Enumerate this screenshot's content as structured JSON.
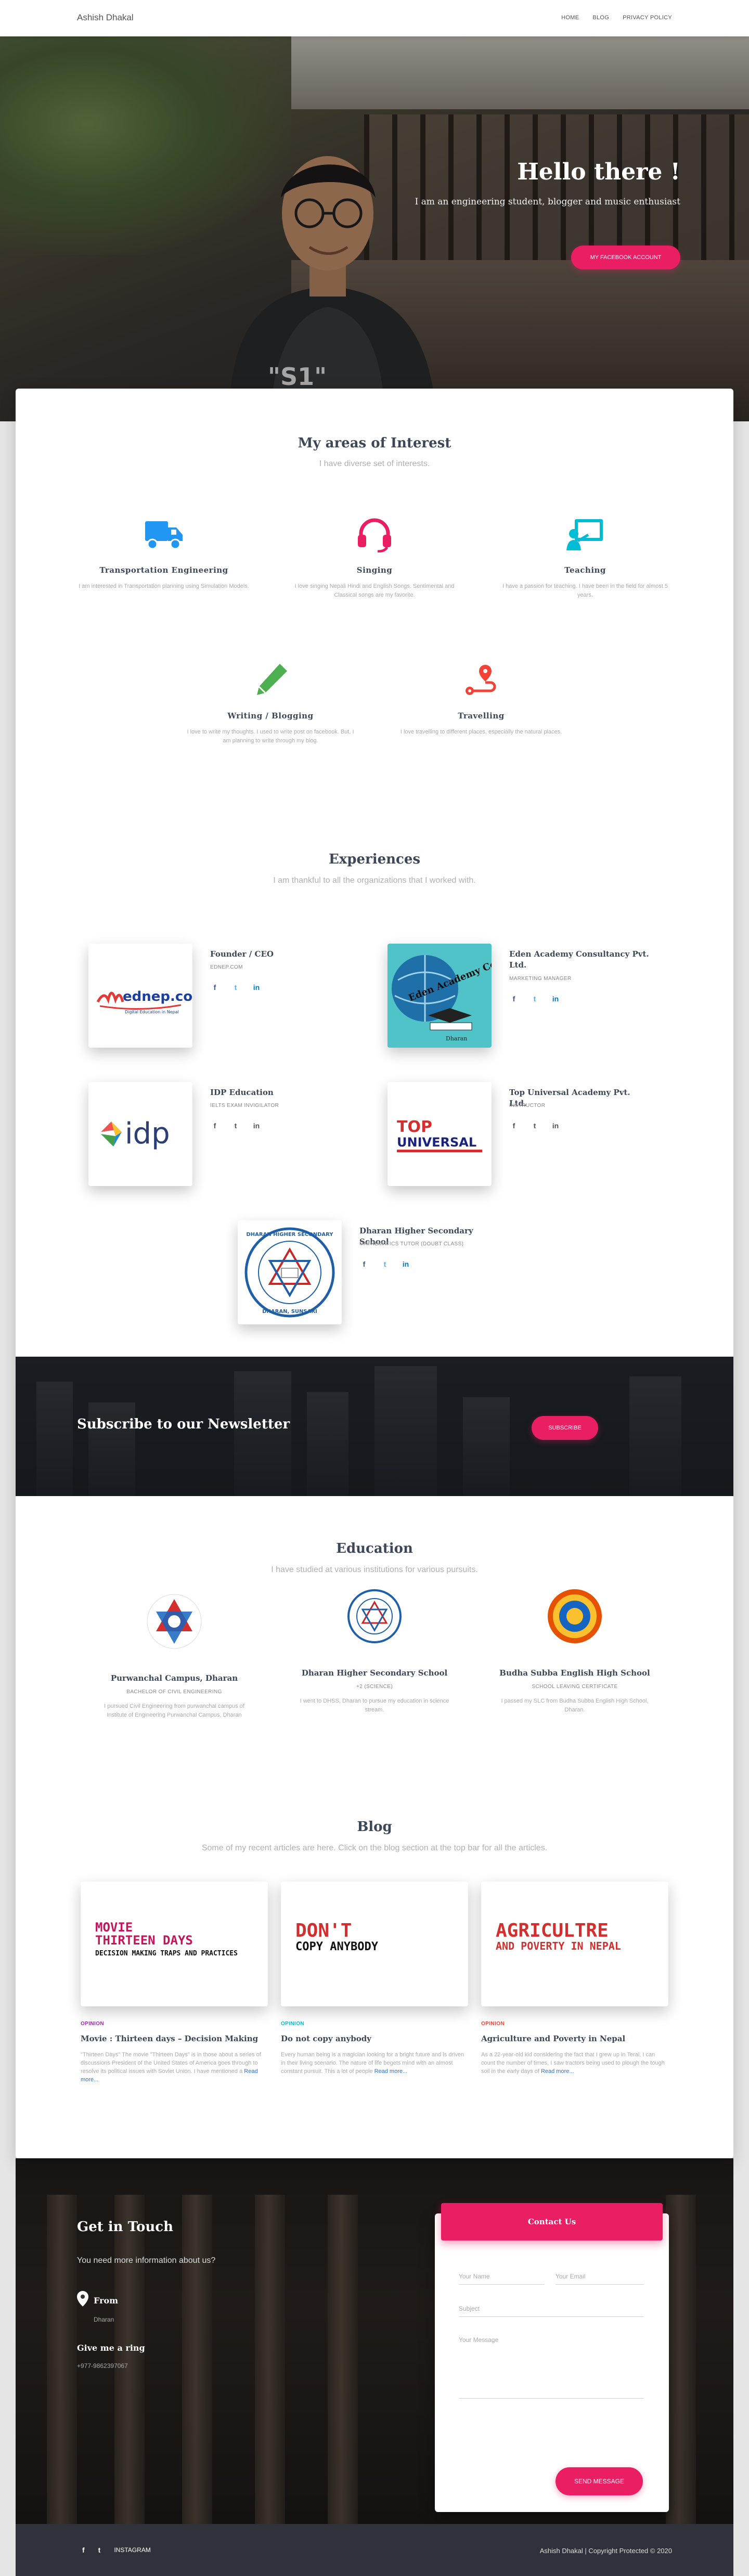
{
  "navbar": {
    "brand": "Ashish Dhakal",
    "links": [
      "HOME",
      "BLOG",
      "PRIVACY POLICY"
    ]
  },
  "hero": {
    "title": "Hello there !",
    "subtitle": "I am an engineering student, blogger and music enthusiast",
    "button": "MY FACEBOOK ACCOUNT",
    "photo_text": "\"S1\""
  },
  "interests": {
    "title": "My areas of Interest",
    "subtitle": "I have diverse set of interests.",
    "items": [
      {
        "icon": "truck-icon",
        "color": "#2196f3",
        "title": "Transportation Engineering",
        "desc": "I am interested in Transportation planning using Simulation Models."
      },
      {
        "icon": "headset-icon",
        "color": "#e91e63",
        "title": "Singing",
        "desc": "I love singing Nepali Hindi and English Songs. Sentimental and Classical songs are my favorite."
      },
      {
        "icon": "teacher-icon",
        "color": "#00bcd4",
        "title": "Teaching",
        "desc": "I have a passion for teaching. I have been in the field for almost 5 years."
      },
      {
        "icon": "pen-icon",
        "color": "#4caf50",
        "title": "Writing / Blogging",
        "desc": "I love to write my thoughts. I used to write post on facebook. But, I am planning to write through my blog."
      },
      {
        "icon": "route-icon",
        "color": "#f44336",
        "title": "Travelling",
        "desc": "I love travelling to different places, especially the natural places."
      }
    ]
  },
  "experiences": {
    "title": "Experiences",
    "subtitle": "I am thankful to all the organizations that I worked with.",
    "items": [
      {
        "role": "Founder / CEO",
        "org": "EDNEP.COM",
        "logo": "ednep.com",
        "logo_sub": "Digital Education in Nepal"
      },
      {
        "role": "Eden Academy Consultancy Pvt. Ltd.",
        "org": "MARKETING MANAGER",
        "logo": "Eden Academy Consultancy Pvt.Ltd",
        "logo_sub": "Dharan"
      },
      {
        "role": "IDP Education",
        "org": "IELTS EXAM INVIGILATOR",
        "logo": "idp"
      },
      {
        "role": "Top Universal Academy Pvt. Ltd.",
        "org": "INSTRUCTOR",
        "logo": "TOP",
        "logo_sub": "UNIVERSAL"
      },
      {
        "role": "Dharan Higher Secondary School",
        "org": "MATHEMATICS TUTOR (DOUBT CLASS)",
        "logo": "DHARAN HIGHER SECONDARY",
        "logo_sub": "DHARAN, SUNSARI"
      }
    ],
    "social": [
      "f",
      "t",
      "in"
    ]
  },
  "newsletter": {
    "title": "Subscribe to our Newsletter",
    "button": "SUBSCRIBE"
  },
  "education": {
    "title": "Education",
    "subtitle": "I have studied at various institutions for various pursuits.",
    "items": [
      {
        "title": "Purwanchal Campus, Dharan",
        "org": "BACHELOR OF CIVIL ENGINEERING",
        "desc": "I pursued Civil Engineering from purwanchal campus of Institute of Engineering Purwanchal Campus, Dharan"
      },
      {
        "title": "Dharan Higher Secondary School",
        "org": "+2 (SCIENCE)",
        "desc": "I went to DHSS, Dharan to pursue my education in science stream."
      },
      {
        "title": "Budha Subba English High School",
        "org": "SCHOOL LEAVING CERTIFICATE",
        "desc": "I passed my SLC from Budha Subba English High School, Dharan."
      }
    ]
  },
  "blog": {
    "title": "Blog",
    "subtitle": "Some of my recent articles are here. Click on the blog section at the top bar for all the articles.",
    "posts": [
      {
        "cover_line1": "MOVIE",
        "cover_line2": "THIRTEEN DAYS",
        "cover_line3": "DECISION MAKING TRAPS AND PRACTICES",
        "category": "OPINION",
        "category_color": "#9c27b0",
        "title": "Movie : Thirteen days – Decision Making",
        "excerpt": "\"Thirteen Days\" The movie \"Thirteen Days\" is in those about a series of discussions President of the United States of America goes through to resolve its political issues with Soviet Union. I have mentioned a",
        "more": "Read more..."
      },
      {
        "cover_line1": "DON'T",
        "cover_line2": "COPY ANYBODY",
        "cover_line3": "",
        "category": "OPINION",
        "category_color": "#00bcd4",
        "title": "Do not copy anybody",
        "excerpt": "Every human being is a magician looking for a bright future and is driven in their living scenario. The nature of life begets mind with an almost constant pursuit. This a lot of people",
        "more": "Read more..."
      },
      {
        "cover_line1": "AGRICULTRE",
        "cover_line2": "AND POVERTY IN NEPAL",
        "cover_line3": "",
        "category": "OPINION",
        "category_color": "#f44336",
        "title": "Agriculture and Poverty in Nepal",
        "excerpt": "As a 22-year-old kid considering the fact that I grew up in Terai, I can count the number of times, I saw tractors being used to plough the tough soil in the early days of",
        "more": "Read more..."
      }
    ]
  },
  "contact": {
    "title": "Get in Touch",
    "subtitle": "You need more information about us?",
    "from_label": "From",
    "from_value": "Dharan",
    "ring_label": "Give me a ring",
    "ring_value": "+977-9862397067",
    "form": {
      "header": "Contact Us",
      "name": "Your Name",
      "email": "Your Email",
      "subject": "Subject",
      "message": "Your Message",
      "button": "SEND MESSAGE"
    }
  },
  "footer": {
    "links": [
      "f",
      "t",
      "INSTAGRAM"
    ],
    "copyright": "Ashish Dhakal | Copyright Protected © 2020"
  },
  "colors": {
    "accent": "#e91e63",
    "text": "#3c4858",
    "muted": "#aaaaaa",
    "facebook": "#3b5998",
    "twitter": "#55acee",
    "linkedin": "#0976b4"
  }
}
